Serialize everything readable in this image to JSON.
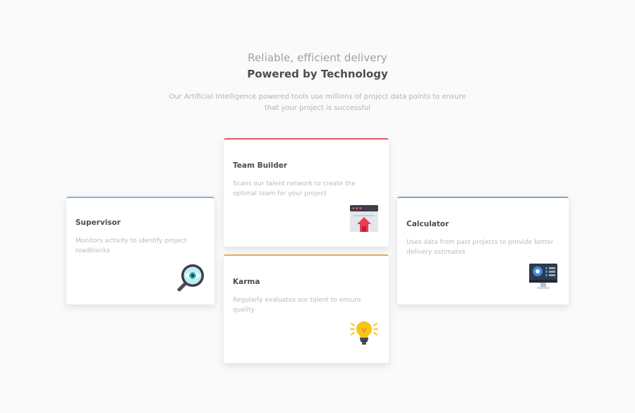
{
  "header": {
    "subtitle": "Reliable, efficient delivery",
    "title": "Powered by Technology",
    "description": "Our Artificial Intelligence powered tools use millions of project data points to ensure that your project is successful"
  },
  "cards": {
    "supervisor": {
      "title": "Supervisor",
      "description": "Monitors activity to identify project roadblocks",
      "accent_color": "#8ab0e0",
      "icon": "magnifying-glass-eye-icon"
    },
    "team_builder": {
      "title": "Team Builder",
      "description": "Scans our talent network to create the optimal team for your project",
      "accent_color": "#e05a6b",
      "icon": "browser-window-upload-icon"
    },
    "karma": {
      "title": "Karma",
      "description": "Regularly evaluates our talent to ensure quality",
      "accent_color": "#eaa655",
      "icon": "lightbulb-icon"
    },
    "calculator": {
      "title": "Calculator",
      "description": "Uses data from past projects to provide better delivery estimates",
      "accent_color": "#7aa8c8",
      "icon": "monitor-dashboard-icon"
    }
  }
}
